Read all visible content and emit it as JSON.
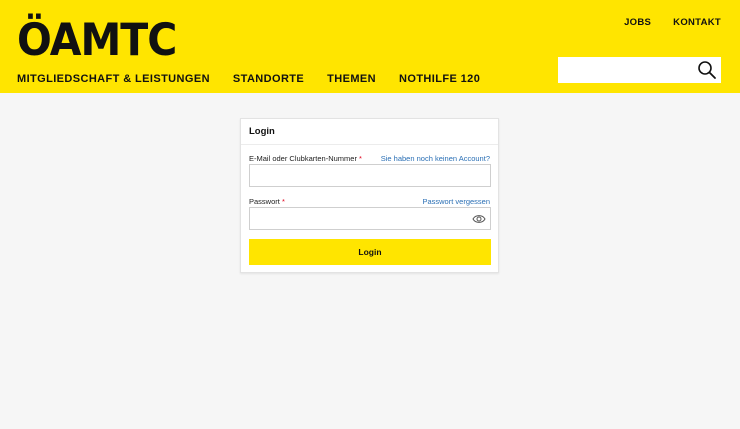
{
  "header": {
    "logo": "ÖAMTC",
    "top_links": [
      "JOBS",
      "KONTAKT"
    ],
    "main_nav": [
      "MITGLIEDSCHAFT & LEISTUNGEN",
      "STANDORTE",
      "THEMEN",
      "NOTHILFE 120"
    ],
    "search": {
      "value": "",
      "placeholder": ""
    },
    "brand_color": "#ffe500"
  },
  "login": {
    "title": "Login",
    "email_label": "E-Mail oder Clubkarten-Nummer",
    "required_mark": "*",
    "no_account_link": "Sie haben noch keinen Account?",
    "email_value": "",
    "password_label": "Passwort",
    "forgot_link": "Passwort vergessen",
    "password_value": "",
    "submit_label": "Login"
  }
}
